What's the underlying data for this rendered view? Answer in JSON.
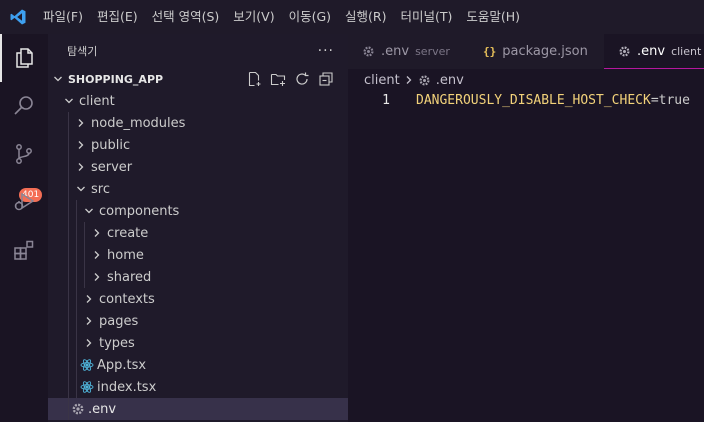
{
  "menu": [
    "파일(F)",
    "편집(E)",
    "선택 영역(S)",
    "보기(V)",
    "이동(G)",
    "실행(R)",
    "터미널(T)",
    "도움말(H)"
  ],
  "activity": {
    "scm_badge": "401"
  },
  "sidebar": {
    "title": "탐색기",
    "more_icon": "···",
    "section_title": "SHOPPING_APP",
    "tree": [
      {
        "label": "client"
      },
      {
        "label": "node_modules"
      },
      {
        "label": "public"
      },
      {
        "label": "server"
      },
      {
        "label": "src"
      },
      {
        "label": "components"
      },
      {
        "label": "create"
      },
      {
        "label": "home"
      },
      {
        "label": "shared"
      },
      {
        "label": "contexts"
      },
      {
        "label": "pages"
      },
      {
        "label": "types"
      },
      {
        "label": "App.tsx"
      },
      {
        "label": "index.tsx"
      },
      {
        "label": ".env"
      }
    ]
  },
  "tabs": [
    {
      "label": ".env",
      "desc": "server"
    },
    {
      "label": "package.json",
      "desc": ""
    },
    {
      "label": ".env",
      "desc": "client"
    }
  ],
  "breadcrumb": {
    "folder": "client",
    "file": ".env"
  },
  "editor": {
    "line_number": "1",
    "key": "DANGEROUSLY_DISABLE_HOST_CHECK",
    "eq": "=",
    "value": "true"
  },
  "colors": {
    "accent": "#b5179e",
    "badge": "#f46e55",
    "env_key": "#f2d27a",
    "react_icon": "#4fb3d9"
  }
}
